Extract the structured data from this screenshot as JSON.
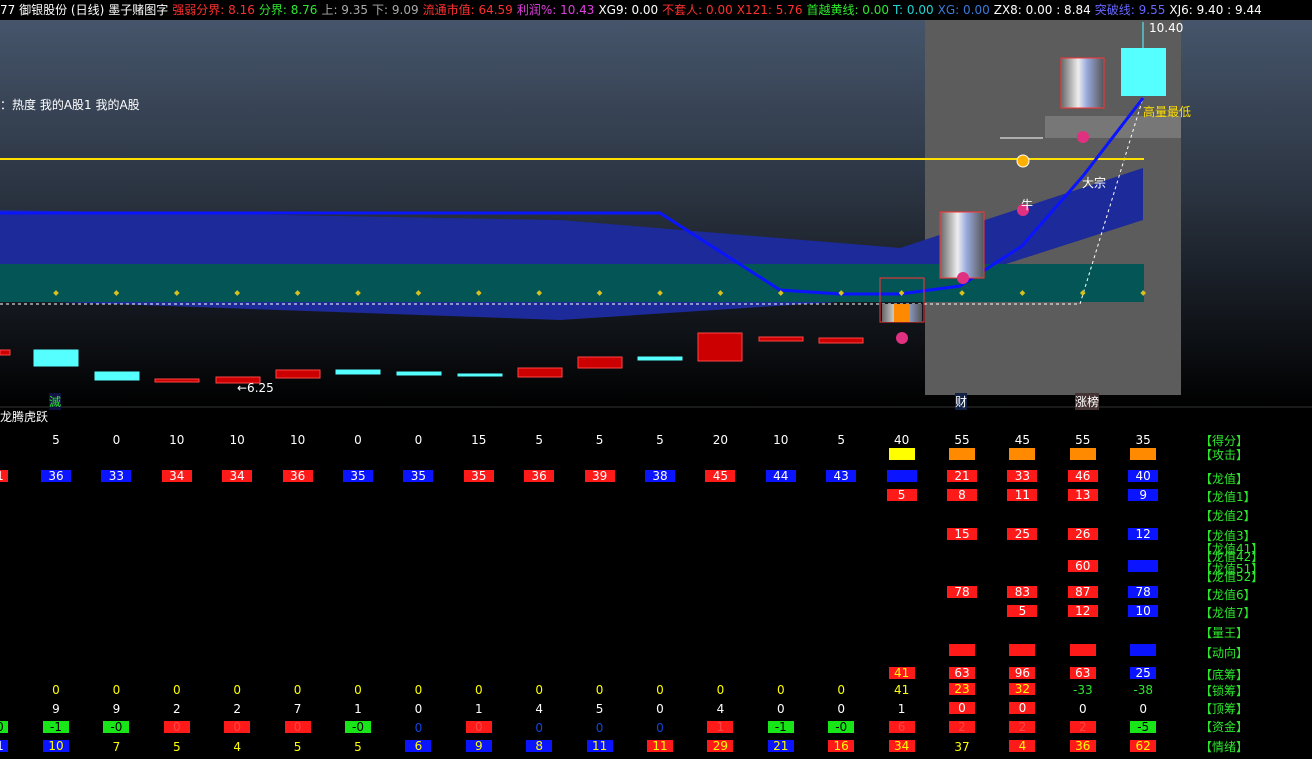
{
  "infobar": [
    {
      "text": "77 御银股份 (日线)",
      "color": "#ffffff"
    },
    {
      "text": "墨子赌图字",
      "color": "#ffffff"
    },
    {
      "text": "强弱分界: 8.16",
      "color": "#ff3030"
    },
    {
      "text": "分界: 8.76",
      "color": "#2ee82e"
    },
    {
      "text": "上: 9.35",
      "color": "#aaaaaa"
    },
    {
      "text": "下: 9.09",
      "color": "#aaaaaa"
    },
    {
      "text": "流通市值: 64.59",
      "color": "#ff3030"
    },
    {
      "text": "利润%: 10.43",
      "color": "#e040e0"
    },
    {
      "text": "XG9: 0.00",
      "color": "#ffffff"
    },
    {
      "text": "不套人: 0.00",
      "color": "#ff3030"
    },
    {
      "text": "X121: 5.76",
      "color": "#ff3030"
    },
    {
      "text": "首越黄线: 0.00",
      "color": "#2ee82e"
    },
    {
      "text": "T: 0.00",
      "color": "#22d4d4"
    },
    {
      "text": "XG: 0.00",
      "color": "#3a7ad8"
    },
    {
      "text": "ZX8: 0.00 : 8.84",
      "color": "#ffffff"
    },
    {
      "text": "突破线: 9.55",
      "color": "#6666ff"
    },
    {
      "text": "XJ6: 9.40 : 9.44",
      "color": "#ffffff"
    }
  ],
  "main": {
    "heat_label": "：热度 我的A股1 我的A股",
    "price_high": "10.40",
    "price_low": "←6.25",
    "label_high_low": "高量最低",
    "label_dazong": "大宗",
    "label_niu": "牛",
    "marker_mie": "滅",
    "marker_cai": "财",
    "marker_zhangbang": "涨榜",
    "lower_title": "龙腾虎跃"
  },
  "lower": {
    "score": [
      "5",
      "0",
      "10",
      "10",
      "10",
      "0",
      "0",
      "15",
      "5",
      "5",
      "5",
      "20",
      "10",
      "5",
      "40",
      "55",
      "45",
      "55",
      "35"
    ],
    "longzhi": [
      "36",
      "33",
      "34",
      "34",
      "36",
      "35",
      "35",
      "35",
      "36",
      "39",
      "38",
      "45",
      "44",
      "43",
      "",
      "21",
      "33",
      "46",
      "40"
    ],
    "longzhi_lead": "1",
    "longzhi1": [
      "5",
      "8",
      "11",
      "13",
      "9"
    ],
    "longzhi3": [
      "15",
      "25",
      "26",
      "12"
    ],
    "longzhi5": [
      "60",
      ""
    ],
    "longzhi6": [
      "78",
      "83",
      "87",
      "78"
    ],
    "longzhi7": [
      "5",
      "12",
      "10"
    ],
    "dichou": [
      "41",
      "63",
      "96",
      "63",
      "25"
    ],
    "suochou": [
      "0",
      "0",
      "0",
      "0",
      "0",
      "0",
      "0",
      "0",
      "0",
      "0",
      "0",
      "0",
      "0",
      "0",
      "41",
      "23",
      "32",
      "-33",
      "-38"
    ],
    "dingchou": [
      "9",
      "9",
      "2",
      "2",
      "7",
      "1",
      "0",
      "1",
      "4",
      "5",
      "0",
      "4",
      "0",
      "0",
      "1",
      "0",
      "0",
      "0",
      "0"
    ],
    "zijin": [
      "-1",
      "-0",
      "0",
      "0",
      "0",
      "-0",
      "0",
      "0",
      "0",
      "0",
      "0",
      "1",
      "-1",
      "-0",
      "6",
      "2",
      "2",
      "2",
      "-5"
    ],
    "zijin_lead": "0",
    "qingxu": [
      "10",
      "7",
      "5",
      "4",
      "5",
      "5",
      "6",
      "9",
      "8",
      "11",
      "11",
      "29",
      "21",
      "16",
      "34",
      "37",
      "4",
      "36",
      "62"
    ],
    "qingxu_lead": "1",
    "row_labels": [
      "【得分】",
      "【攻击】",
      "【龙值】",
      "【龙值1】",
      "【龙值2】",
      "【龙值3】",
      "【龙值41】",
      "【龙值42】",
      "【龙值51】",
      "【龙值52】",
      "【龙值6】",
      "【龙值7】",
      "【量王】",
      "【动向】",
      "【底筹】",
      "【锁筹】",
      "【顶筹】",
      "【资金】",
      "【情绪】"
    ]
  },
  "colors": {
    "red": "#ff1a1a",
    "blue": "#0a14ff",
    "green": "#19e619",
    "orange": "#ff8a00",
    "yellow": "#ffff00",
    "label_green": "#2ee82e"
  }
}
